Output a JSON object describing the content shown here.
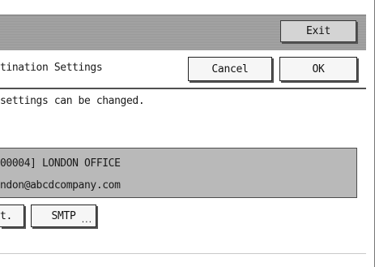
{
  "toolbar": {
    "exit_label": "Exit"
  },
  "header": {
    "title": "tination Settings",
    "cancel_label": "Cancel",
    "ok_label": "OK"
  },
  "message": {
    "text": "settings can be changed."
  },
  "destination": {
    "name_line": "00004] LONDON OFFICE",
    "email_line": "ndon@abcdcompany.com"
  },
  "buttons": {
    "ext_label": "t.",
    "smtp_label": "SMTP",
    "smtp_more": "..."
  }
}
